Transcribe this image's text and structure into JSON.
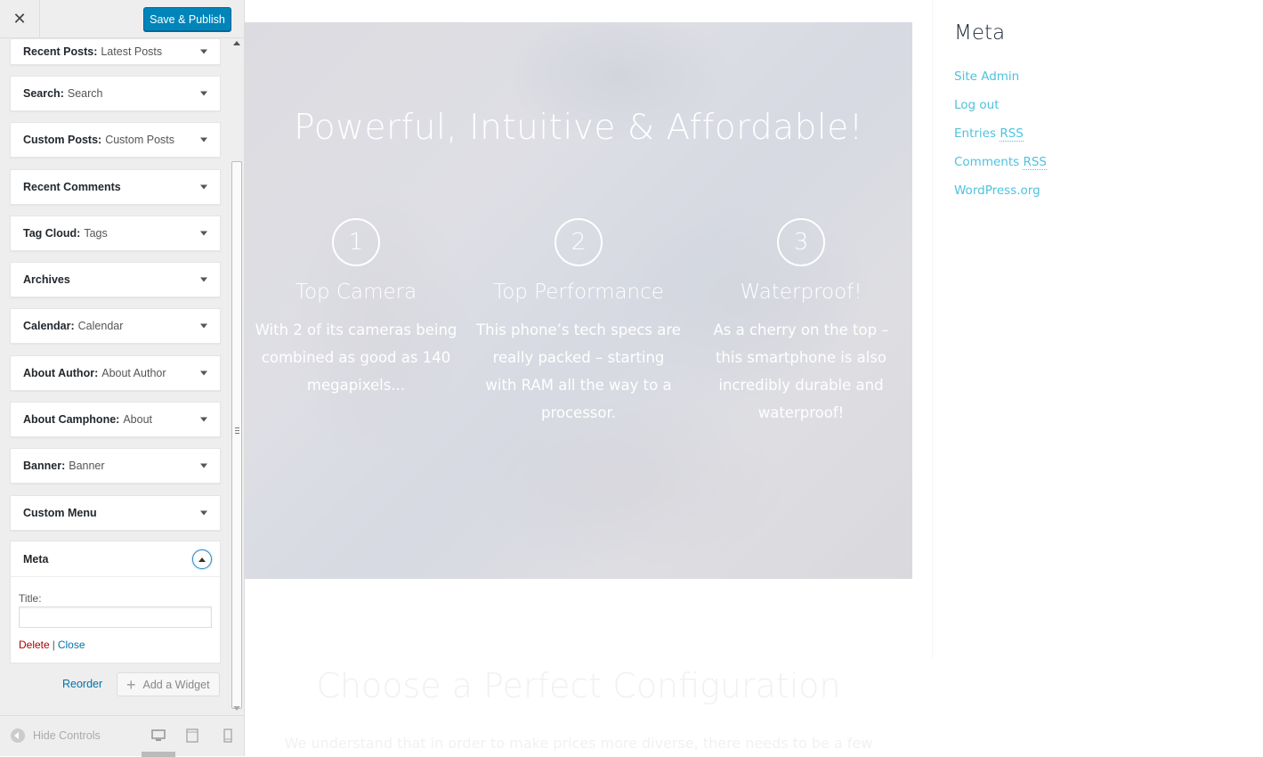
{
  "topbar": {
    "close_symbol": "✕",
    "publish_label": "Save & Publish"
  },
  "widgets": [
    {
      "name": "Recent Posts:",
      "sub": "Latest Posts"
    },
    {
      "name": "Search:",
      "sub": "Search"
    },
    {
      "name": "Custom Posts:",
      "sub": "Custom Posts"
    },
    {
      "name": "Recent Comments",
      "sub": ""
    },
    {
      "name": "Tag Cloud:",
      "sub": "Tags"
    },
    {
      "name": "Archives",
      "sub": ""
    },
    {
      "name": "Calendar:",
      "sub": "Calendar"
    },
    {
      "name": "About Author:",
      "sub": "About Author"
    },
    {
      "name": "About Camphone:",
      "sub": "About"
    },
    {
      "name": "Banner:",
      "sub": "Banner"
    },
    {
      "name": "Custom Menu",
      "sub": ""
    }
  ],
  "meta_widget": {
    "name": "Meta",
    "title_label": "Title:",
    "title_value": "",
    "delete_label": "Delete",
    "separator": "|",
    "close_label": "Close"
  },
  "actions": {
    "reorder_label": "Reorder",
    "add_widget_label": "Add a Widget",
    "add_symbol": "+"
  },
  "footer": {
    "hide_controls_label": "Hide Controls"
  },
  "hero": {
    "title": "Powerful, Intuitive & Affordable!",
    "features": [
      {
        "number": "1",
        "title": "Top Camera",
        "desc": "With 2 of its cameras being combined as good as 140 megapixels..."
      },
      {
        "number": "2",
        "title": "Top Performance",
        "desc": "This phone’s tech specs are really packed – starting with RAM all the way to a processor."
      },
      {
        "number": "3",
        "title": "Waterproof!",
        "desc": "As a cherry on the top – this smartphone is also incredibly durable and waterproof!"
      }
    ]
  },
  "config": {
    "title": "Choose a Perfect Configuration",
    "text": "We understand that in order to make prices more diverse, there needs to be a few"
  },
  "sidebar_meta": {
    "heading": "Meta",
    "links": [
      {
        "text": "Site Admin",
        "abbr": ""
      },
      {
        "text": "Log out",
        "abbr": ""
      },
      {
        "text": "Entries ",
        "abbr": "RSS"
      },
      {
        "text": "Comments ",
        "abbr": "RSS"
      },
      {
        "text": "WordPress.org",
        "abbr": ""
      }
    ]
  },
  "colors": {
    "accent": "#0085ba",
    "link": "#4ec2dd",
    "delete": "#aa0000"
  }
}
